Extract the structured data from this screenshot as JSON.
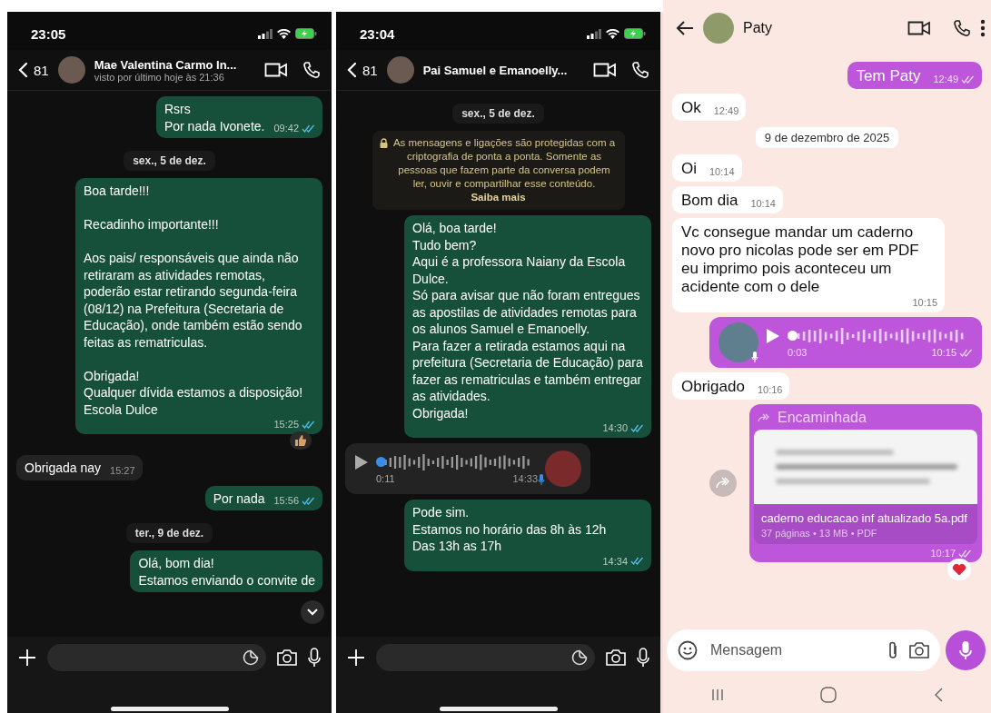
{
  "panels": [
    {
      "kind": "ios_dark",
      "status_bar": {
        "time": "23:05"
      },
      "header": {
        "back_count": "81",
        "name": "Mae Valentina Carmo In...",
        "subtitle": "visto por último hoje às 21:36"
      },
      "scroll_to_bottom": true,
      "messages": [
        {
          "kind": "text",
          "outgoing": true,
          "text": "Rsrs\nPor nada Ivonete.",
          "time": "09:42",
          "read": true
        },
        {
          "kind": "date",
          "text": "sex., 5 de dez."
        },
        {
          "kind": "text",
          "outgoing": true,
          "text": "Boa tarde!!!\n\nRecadinho importante!!!\n\nAos pais/ responsáveis que ainda não retiraram as atividades remotas, poderão estar retirando segunda-feira (08/12) na Prefeitura (Secretaria de Educação), onde também estão sendo feitas as rematriculas.\n\nObrigada!\nQualquer dívida estamos a disposição!\nEscola Dulce",
          "time": "15:25",
          "read": true,
          "liked": true
        },
        {
          "kind": "text",
          "outgoing": false,
          "text": "Obrigada nay",
          "time": "15:27"
        },
        {
          "kind": "text",
          "outgoing": true,
          "text": "Por nada",
          "time": "15:56",
          "read": true
        },
        {
          "kind": "date",
          "text": "ter., 9 de dez."
        },
        {
          "kind": "text",
          "outgoing": true,
          "text": "Olá, bom dia!\nEstamos enviando o convite de"
        }
      ]
    },
    {
      "kind": "ios_dark",
      "status_bar": {
        "time": "23:04"
      },
      "header": {
        "back_count": "81",
        "name": "Pai Samuel e Emanoelly..."
      },
      "scroll_to_bottom": false,
      "messages": [
        {
          "kind": "date",
          "text": "sex., 5 de dez."
        },
        {
          "kind": "system",
          "text": "As mensagens e ligações são protegidas com a criptografia de ponta a ponta. Somente as pessoas que fazem parte da conversa podem ler, ouvir e compartilhar esse conteúdo.",
          "link": "Saiba mais"
        },
        {
          "kind": "text",
          "outgoing": true,
          "text": "Olá, boa tarde!\nTudo bem?\nAqui é a professora Naiany da Escola Dulce.\nSó para avisar que não foram entregues as apostilas de atividades remotas para os alunos Samuel e Emanoelly.\nPara fazer a retirada estamos aqui na prefeitura (Secretaria de Educação) para fazer as rematriculas e também entregar as atividades.\nObrigada!",
          "time": "14:30",
          "read": true
        },
        {
          "kind": "audio",
          "outgoing": false,
          "duration": "0:11",
          "time": "14:33"
        },
        {
          "kind": "text",
          "outgoing": true,
          "text": "Pode sim.\nEstamos no horário das 8h às 12h\nDas 13h as 17h",
          "time": "14:34",
          "read": true
        }
      ]
    },
    {
      "kind": "android_light",
      "header": {
        "name": "Paty"
      },
      "composer": {
        "placeholder": "Mensagem"
      },
      "messages": [
        {
          "kind": "text",
          "outgoing": true,
          "text": "Tem Paty",
          "time": "12:49",
          "read": false
        },
        {
          "kind": "text",
          "outgoing": false,
          "text": "Ok",
          "time": "12:49"
        },
        {
          "kind": "date",
          "text": "9 de dezembro de 2025"
        },
        {
          "kind": "text",
          "outgoing": false,
          "text": "Oi",
          "time": "10:14"
        },
        {
          "kind": "text",
          "outgoing": false,
          "text": "Bom dia",
          "time": "10:14"
        },
        {
          "kind": "text",
          "outgoing": false,
          "text": "Vc consegue mandar um caderno novo pro nicolas pode ser em PDF eu imprimo pois aconteceu um acidente com o dele",
          "time": "10:15"
        },
        {
          "kind": "audio",
          "outgoing": true,
          "duration": "0:03",
          "time": "10:15",
          "read": false
        },
        {
          "kind": "text",
          "outgoing": false,
          "text": "Obrigado",
          "time": "10:16"
        },
        {
          "kind": "document",
          "outgoing": true,
          "forwarded_label": "Encaminhada",
          "file_name": "caderno educacao inf atualizado 5a.pdf",
          "file_meta": "37 páginas • 13 MB • PDF",
          "time": "10:17",
          "read": false,
          "loved": true
        }
      ]
    }
  ]
}
